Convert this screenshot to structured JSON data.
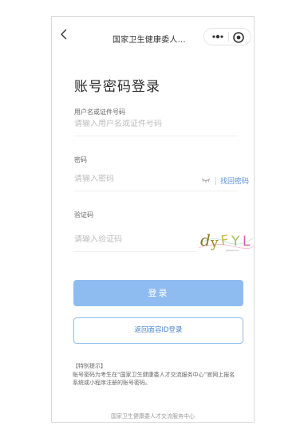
{
  "nav": {
    "title": "国家卫生健康委人...",
    "back_icon": "chevron-left-icon",
    "more_icon": "more-dots-icon",
    "close_icon": "target-close-icon"
  },
  "page": {
    "title": "账号密码登录"
  },
  "form": {
    "username_label": "用户名或证件号码",
    "username_placeholder": "请输入用户名或证件号码",
    "password_label": "密码",
    "password_placeholder": "请输入密码",
    "find_password": "找回密码",
    "captcha_label": "验证码",
    "captcha_placeholder": "请输入验证码",
    "captcha_text": "dyFYL"
  },
  "buttons": {
    "login": "登录",
    "face_id_login": "返回面容ID登录"
  },
  "notice": {
    "title": "【特别提示】",
    "text": "账号密码为考生在“国家卫生健康委人才交流服务中心”官网上报名系统或小程序注册的账号密码。"
  },
  "footer": {
    "text": "国家卫生健康委人才交流服务中心"
  },
  "colors": {
    "accent": "#8fbcf0",
    "link": "#5a8fd8"
  }
}
